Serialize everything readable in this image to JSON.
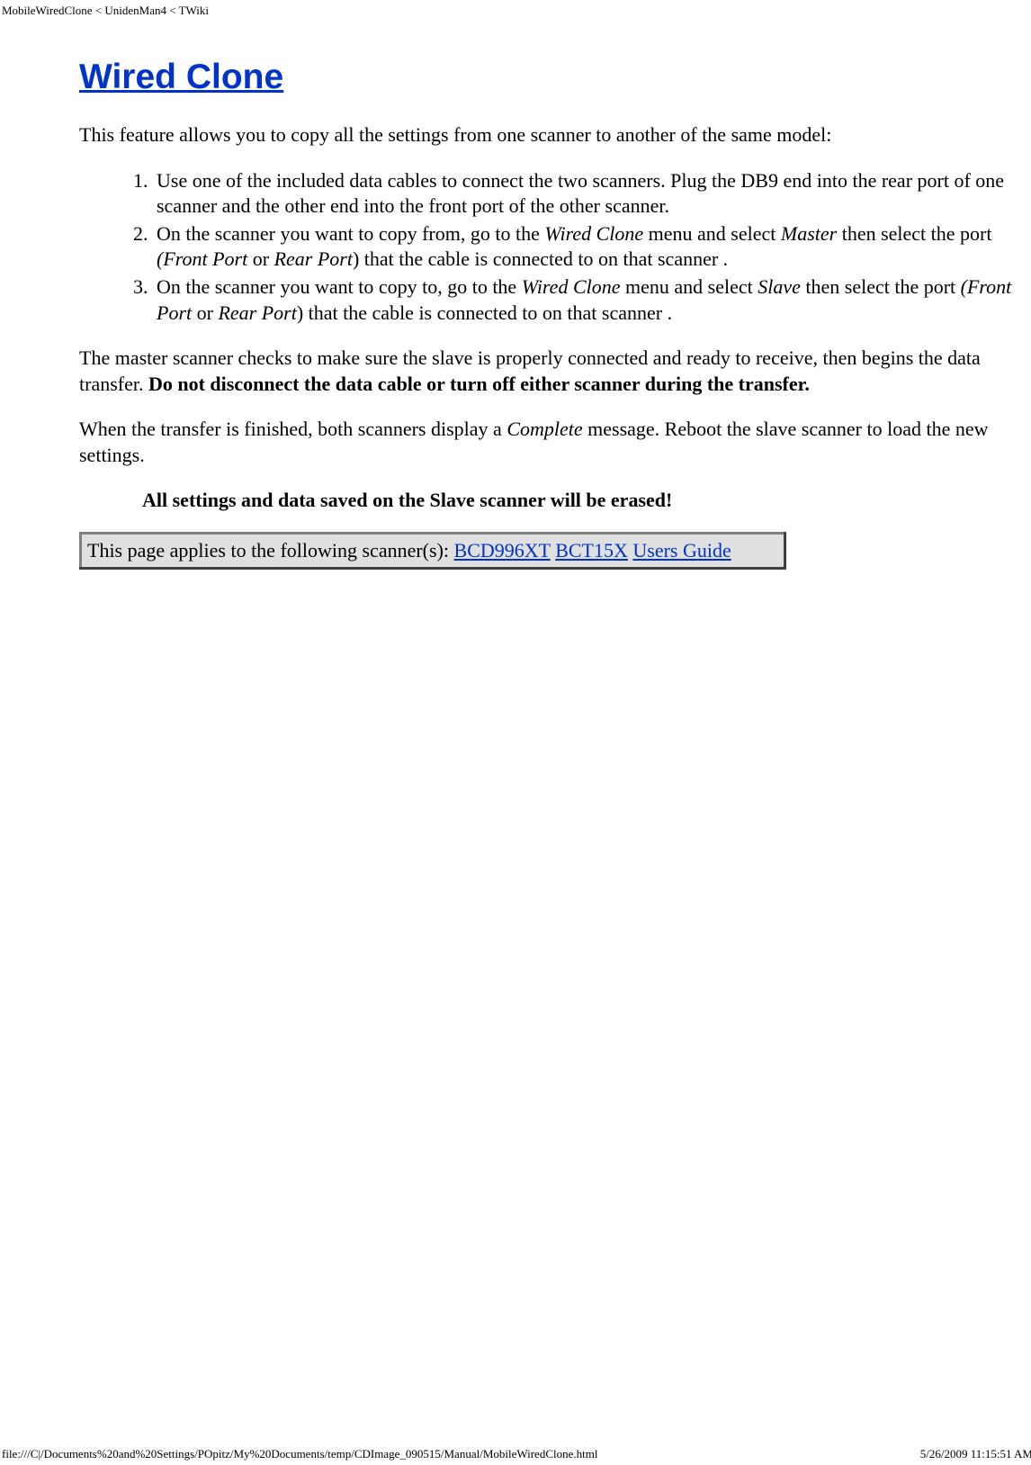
{
  "header": {
    "breadcrumb": "MobileWiredClone < UnidenMan4 < TWiki"
  },
  "title": "Wired Clone",
  "intro": "This feature allows you to copy all the settings from one scanner to another of the same model:",
  "steps": {
    "step1": "Use one of the included data cables to connect the two scanners. Plug the DB9 end into the rear port of one scanner and the other end into the front port of the other scanner.",
    "step2_a": "On the scanner you want to copy from, go to the ",
    "step2_wired": "Wired Clone",
    "step2_b": " menu and select ",
    "step2_master": "Master",
    "step2_c": " then select the port ",
    "step2_ports": "(Front Port",
    "step2_or": " or ",
    "step2_rear": "Rear Port",
    "step2_d": ") that the cable is connected to on that scanner .",
    "step3_a": "On the scanner you want to copy to, go to the ",
    "step3_wired": "Wired Clone",
    "step3_b": " menu and select ",
    "step3_slave": "Slave",
    "step3_c": " then select the port ",
    "step3_ports": "(Front Port",
    "step3_or": " or ",
    "step3_rear": "Rear Port",
    "step3_d": ") that the cable is connected to on that scanner ."
  },
  "para_master_a": "The master scanner checks to make sure the slave is properly connected and ready to receive, then begins the data transfer. ",
  "para_master_b": "Do not disconnect the data cable or turn off either scanner during the transfer.",
  "para_complete_a": "When the transfer is finished, both scanners display a ",
  "para_complete_b": "Complete",
  "para_complete_c": " message. Reboot the slave scanner to load the new settings.",
  "warning": "All settings and data saved on the Slave scanner will be erased!",
  "applies": {
    "prefix": "This page applies to the following scanner(s): ",
    "link1": "BCD996XT",
    "link2": "BCT15X",
    "link3": "Users Guide"
  },
  "footer": {
    "path": "file:///C|/Documents%20and%20Settings/POpitz/My%20Documents/temp/CDImage_090515/Manual/MobileWiredClone.html",
    "date": "5/26/2009 11:15:51 AM"
  }
}
